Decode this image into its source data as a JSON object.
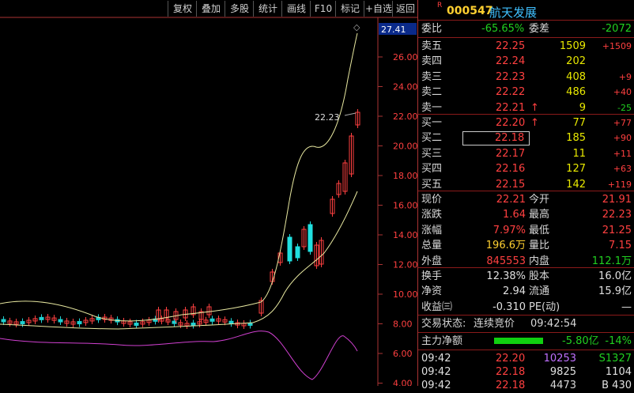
{
  "toolbar": {
    "buttons": [
      "复权",
      "叠加",
      "多股",
      "统计",
      "画线",
      "F10",
      "标记",
      "+自选",
      "返回"
    ]
  },
  "chart": {
    "price_box": "27.41",
    "y_ticks": [
      "26.00",
      "24.00",
      "22.00",
      "20.00",
      "18.00",
      "16.00",
      "14.00",
      "12.00",
      "10.00",
      "8.00",
      "6.00",
      "4.00"
    ],
    "last_label": "22.23"
  },
  "stock": {
    "badge": "R",
    "code": "000547",
    "name": "航天发展"
  },
  "ratio": {
    "label1": "委比",
    "val1": "-65.65%",
    "label2": "委差",
    "val2": "-2072"
  },
  "asks": [
    {
      "label": "卖五",
      "price": "22.25",
      "vol": "1509",
      "chg": "+1509"
    },
    {
      "label": "卖四",
      "price": "22.24",
      "vol": "202",
      "chg": ""
    },
    {
      "label": "卖三",
      "price": "22.23",
      "vol": "408",
      "chg": "+9"
    },
    {
      "label": "卖二",
      "price": "22.22",
      "vol": "486",
      "chg": "+40"
    },
    {
      "label": "卖一",
      "price": "22.21",
      "vol": "9",
      "chg": "-25",
      "arrow": "↑"
    }
  ],
  "bids": [
    {
      "label": "买一",
      "price": "22.20",
      "vol": "77",
      "chg": "+77",
      "arrow": "↑"
    },
    {
      "label": "买二",
      "price": "22.18",
      "vol": "185",
      "chg": "+90"
    },
    {
      "label": "买三",
      "price": "22.17",
      "vol": "11",
      "chg": "+11"
    },
    {
      "label": "买四",
      "price": "22.16",
      "vol": "127",
      "chg": "+63"
    },
    {
      "label": "买五",
      "price": "22.15",
      "vol": "142",
      "chg": "+119"
    }
  ],
  "quote": [
    {
      "l1": "现价",
      "v1": "22.21",
      "l2": "今开",
      "v2": "21.91"
    },
    {
      "l1": "涨跌",
      "v1": "1.64",
      "l2": "最高",
      "v2": "22.23"
    },
    {
      "l1": "涨幅",
      "v1": "7.97%",
      "l2": "最低",
      "v2": "21.25"
    },
    {
      "l1": "总量",
      "v1": "196.6万",
      "l2": "量比",
      "v2": "7.15"
    },
    {
      "l1": "外盘",
      "v1": "845553",
      "l2": "内盘",
      "v2": "112.1万"
    }
  ],
  "fund": [
    {
      "l1": "换手",
      "v1": "12.38%",
      "l2": "股本",
      "v2": "16.0亿"
    },
    {
      "l1": "净资",
      "v1": "2.94",
      "l2": "流通",
      "v2": "15.9亿"
    },
    {
      "l1": "收益㈢",
      "v1": "-0.310",
      "l2": "PE(动)",
      "v2": "—"
    }
  ],
  "status": {
    "label": "交易状态:",
    "value": "连续竞价",
    "time": "09:42:54"
  },
  "main_flow": {
    "label": "主力净额",
    "value": "-5.80亿",
    "pct": "-14%"
  },
  "ticks": [
    {
      "time": "09:42",
      "price": "22.20",
      "vol": "10253",
      "n": "S1327"
    },
    {
      "time": "09:42",
      "price": "22.18",
      "vol": "9825",
      "n": "1104"
    },
    {
      "time": "09:42",
      "price": "22.18",
      "vol": "4473",
      "n": "B 430"
    }
  ]
}
